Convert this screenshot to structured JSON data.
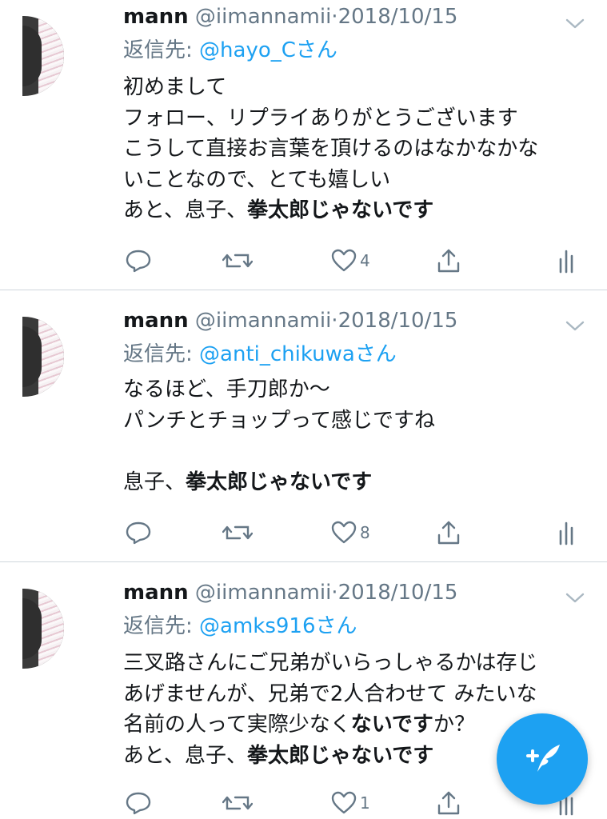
{
  "tweets": [
    {
      "name": "mann",
      "handle": "@iimannamii",
      "dot": "·",
      "date": "2018/10/15",
      "reply_label": "返信先:",
      "reply_to": "@hayo_Cさん",
      "lines": [
        {
          "parts": [
            {
              "text": "初めまして",
              "bold": false
            }
          ]
        },
        {
          "parts": [
            {
              "text": "フォロー、リプライありがとうございます",
              "bold": false
            }
          ]
        },
        {
          "parts": [
            {
              "text": "こうして直接お言葉を頂けるのはなかなかな",
              "bold": false
            }
          ]
        },
        {
          "parts": [
            {
              "text": "いことなので、とても嬉しい",
              "bold": false
            }
          ]
        },
        {
          "parts": [
            {
              "text": "あと、息子、",
              "bold": false
            },
            {
              "text": "拳太郎じゃないです",
              "bold": true
            }
          ]
        }
      ],
      "like_count": "4"
    },
    {
      "name": "mann",
      "handle": "@iimannamii",
      "dot": "·",
      "date": "2018/10/15",
      "reply_label": "返信先:",
      "reply_to": "@anti_chikuwaさん",
      "lines": [
        {
          "parts": [
            {
              "text": "なるほど、手刀郎か〜",
              "bold": false
            }
          ]
        },
        {
          "parts": [
            {
              "text": "パンチとチョップって感じですね",
              "bold": false
            }
          ]
        },
        {
          "parts": [
            {
              "text": "",
              "bold": false
            }
          ]
        },
        {
          "parts": [
            {
              "text": "息子、",
              "bold": false
            },
            {
              "text": "拳太郎じゃないです",
              "bold": true
            }
          ]
        }
      ],
      "like_count": "8"
    },
    {
      "name": "mann",
      "handle": "@iimannamii",
      "dot": "·",
      "date": "2018/10/15",
      "reply_label": "返信先:",
      "reply_to": "@amks916さん",
      "lines": [
        {
          "parts": [
            {
              "text": "三叉路さんにご兄弟がいらっしゃるかは存じ",
              "bold": false
            }
          ]
        },
        {
          "parts": [
            {
              "text": "あげませんが、兄弟で2人合わせて みたいな",
              "bold": false
            }
          ]
        },
        {
          "parts": [
            {
              "text": "名前の人って実際少なく",
              "bold": false
            },
            {
              "text": "ないです",
              "bold": true
            },
            {
              "text": "か？",
              "bold": false
            }
          ]
        },
        {
          "parts": [
            {
              "text": "あと、息子、",
              "bold": false
            },
            {
              "text": "拳太郎じゃないです",
              "bold": true
            }
          ]
        }
      ],
      "like_count": "1"
    }
  ],
  "icons": {
    "reply": "reply-icon",
    "retweet": "retweet-icon",
    "like": "heart-icon",
    "share": "share-icon",
    "analytics": "analytics-icon",
    "caret": "chevron-down-icon",
    "compose": "compose-tweet-icon"
  },
  "colors": {
    "accent": "#1da1f2",
    "secondary_text": "#657786",
    "primary_text": "#14171a",
    "divider": "#cfd6dc"
  }
}
